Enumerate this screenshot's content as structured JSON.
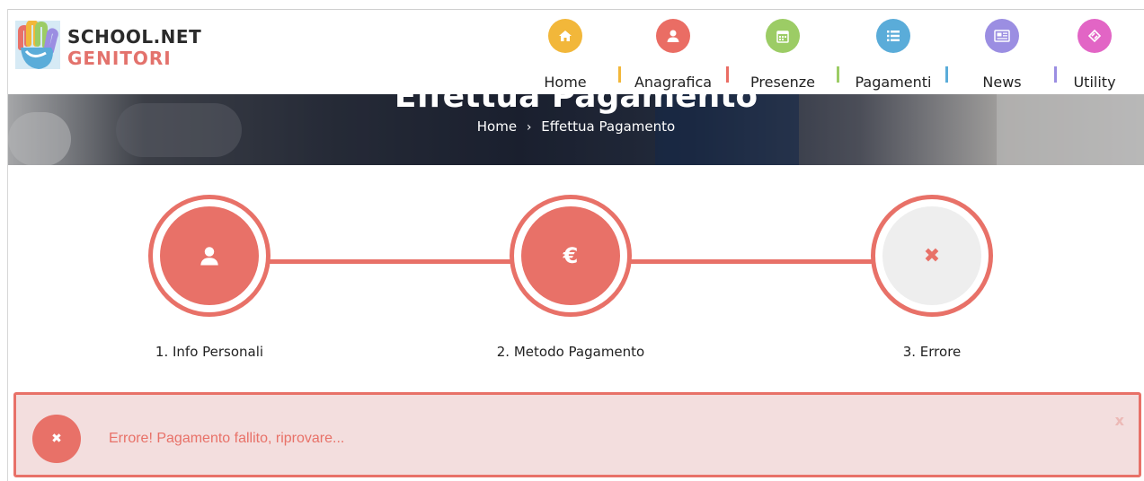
{
  "logo": {
    "line1": "SCHOOL.NET",
    "line2": "GENITORI"
  },
  "nav": [
    {
      "label": "Home",
      "icon": "home-icon",
      "color": "#f2b73a"
    },
    {
      "label": "Anagrafica",
      "icon": "user-icon",
      "color": "#ea6d64"
    },
    {
      "label": "Presenze",
      "icon": "calendar-icon",
      "color": "#9ccc65"
    },
    {
      "label": "Pagamenti",
      "icon": "list-icon",
      "color": "#5aacd9"
    },
    {
      "label": "News",
      "icon": "newspaper-icon",
      "color": "#9b8ee2"
    },
    {
      "label": "Utility",
      "icon": "diamond-arrows-icon",
      "color": "#e265c5"
    }
  ],
  "nav_separator_colors": [
    "#f2b73a",
    "#ea6d64",
    "#9ccc65",
    "#5aacd9",
    "#9b8ee2"
  ],
  "banner": {
    "title": "Effettua Pagamento",
    "breadcrumb": {
      "home": "Home",
      "separator": "›",
      "current": "Effettua Pagamento"
    }
  },
  "steps": [
    {
      "label": "1. Info Personali",
      "icon": "user-icon",
      "state": "done"
    },
    {
      "label": "2. Metodo Pagamento",
      "icon": "euro-icon",
      "icon_text": "€",
      "state": "done"
    },
    {
      "label": "3. Errore",
      "icon": "close-icon",
      "icon_text": "✖",
      "state": "current"
    }
  ],
  "alert": {
    "message": "Errore! Pagamento fallito, riprovare...",
    "close": "x",
    "icon_text": "✖"
  },
  "colors": {
    "accent": "#e87168",
    "alert_bg": "#f3dede",
    "step_pending_bg": "#eeeeee"
  }
}
